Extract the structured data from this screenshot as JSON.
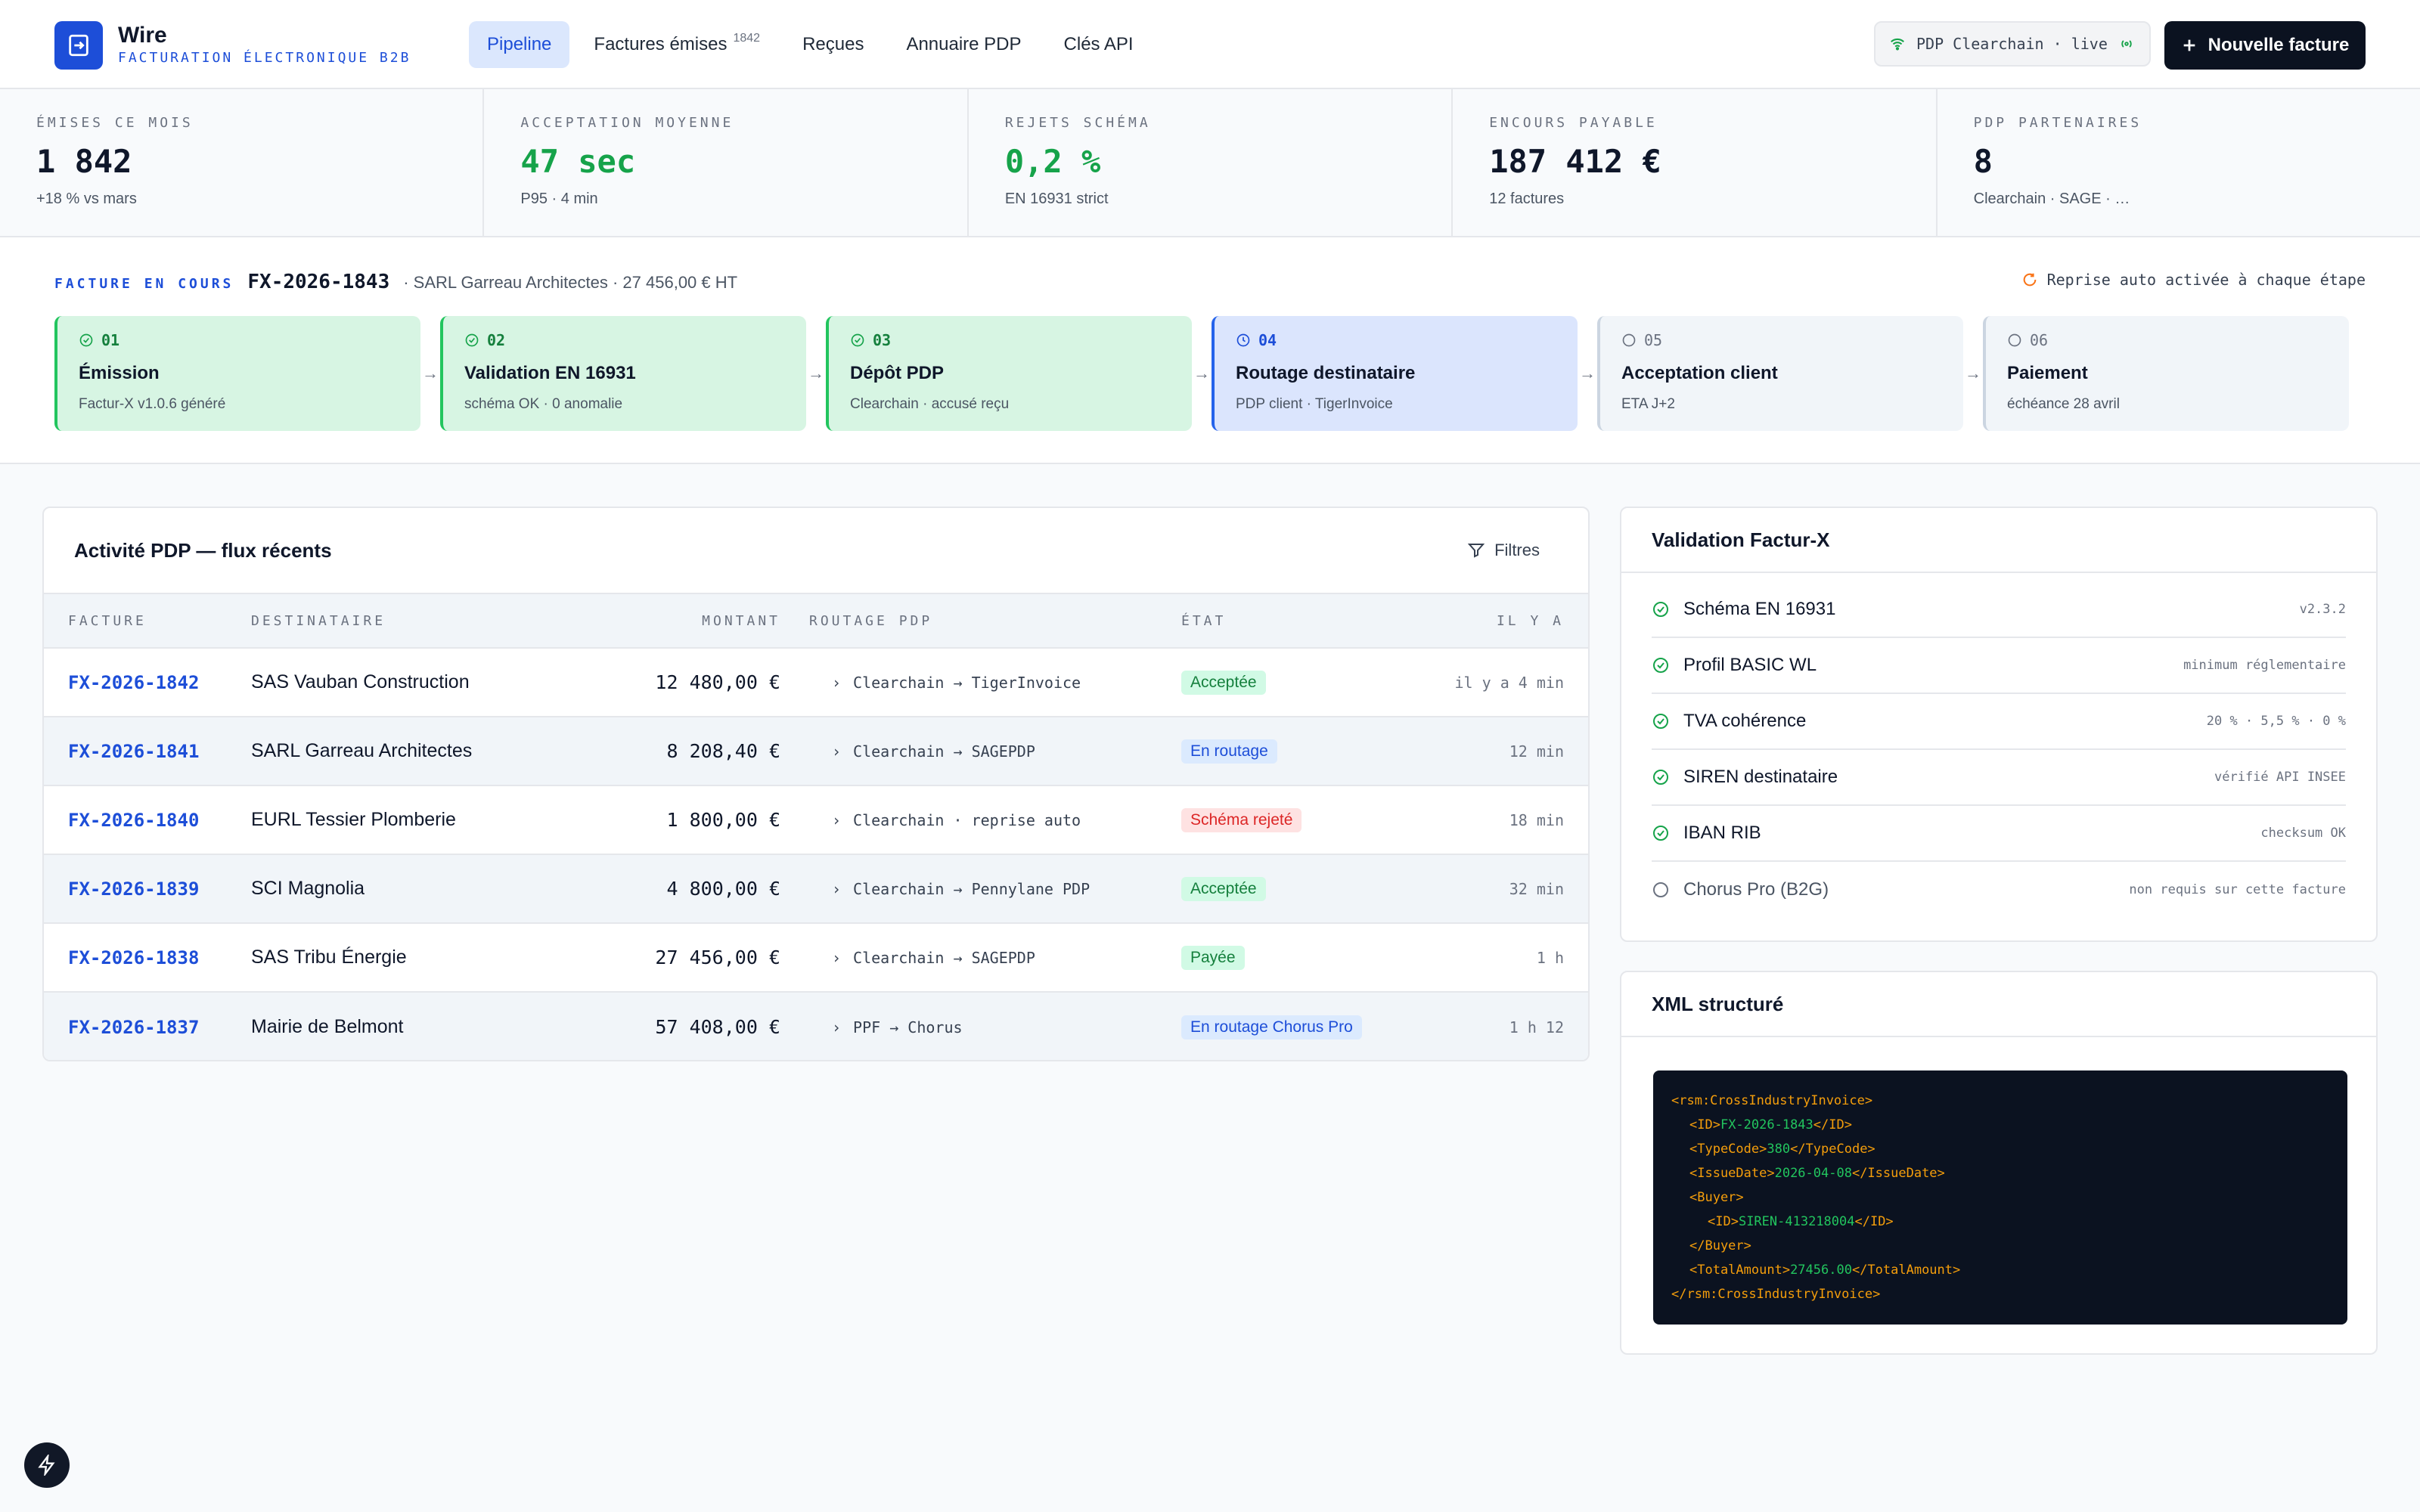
{
  "app": {
    "name": "Wire",
    "subtitle": "FACTURATION ÉLECTRONIQUE B2B"
  },
  "nav": [
    {
      "label": "Pipeline",
      "active": true
    },
    {
      "label": "Factures émises",
      "count": "1842"
    },
    {
      "label": "Reçues"
    },
    {
      "label": "Annuaire PDP"
    },
    {
      "label": "Clés API"
    }
  ],
  "pdp_status": {
    "label": "PDP Clearchain · live"
  },
  "new_invoice_button": {
    "label": "Nouvelle facture"
  },
  "stats": [
    {
      "label": "ÉMISES CE MOIS",
      "value": "1 842",
      "sub": "+18 % vs mars",
      "color": "default"
    },
    {
      "label": "ACCEPTATION MOYENNE",
      "value": "47 sec",
      "sub": "P95 · 4 min",
      "color": "green"
    },
    {
      "label": "REJETS SCHÉMA",
      "value": "0,2 %",
      "sub": "EN 16931 strict",
      "color": "green"
    },
    {
      "label": "ENCOURS PAYABLE",
      "value": "187 412 €",
      "sub": "12 factures",
      "color": "default"
    },
    {
      "label": "PDP PARTENAIRES",
      "value": "8",
      "sub": "Clearchain · SAGE · …",
      "color": "default"
    }
  ],
  "pipeline": {
    "label": "FACTURE EN COURS",
    "invoice_id": "FX-2026-1843",
    "meta": "· SARL Garreau Architectes · 27 456,00 € HT",
    "auto_retry": "Reprise auto activée à chaque étape",
    "steps": [
      {
        "num": "01",
        "title": "Émission",
        "sub": "Factur-X v1.0.6 généré",
        "state": "done"
      },
      {
        "num": "02",
        "title": "Validation EN 16931",
        "sub": "schéma OK · 0 anomalie",
        "state": "done"
      },
      {
        "num": "03",
        "title": "Dépôt PDP",
        "sub": "Clearchain · accusé reçu",
        "state": "done"
      },
      {
        "num": "04",
        "title": "Routage destinataire",
        "sub": "PDP client · TigerInvoice",
        "state": "current"
      },
      {
        "num": "05",
        "title": "Acceptation client",
        "sub": "ETA J+2",
        "state": "pending"
      },
      {
        "num": "06",
        "title": "Paiement",
        "sub": "échéance 28 avril",
        "state": "pending"
      }
    ]
  },
  "activity": {
    "title": "Activité PDP — flux récents",
    "filter_label": "Filtres",
    "columns": [
      "FACTURE",
      "DESTINATAIRE",
      "MONTANT",
      "ROUTAGE PDP",
      "ÉTAT",
      "IL Y A"
    ],
    "rows": [
      {
        "id": "FX-2026-1842",
        "dest": "SAS Vauban Construction",
        "amount": "12 480,00 €",
        "route": "Clearchain → TigerInvoice",
        "state": "Acceptée",
        "state_color": "green",
        "ago": "il y a 4 min"
      },
      {
        "id": "FX-2026-1841",
        "dest": "SARL Garreau Architectes",
        "amount": "8 208,40 €",
        "route": "Clearchain → SAGEPDP",
        "state": "En routage",
        "state_color": "blue",
        "ago": "12 min"
      },
      {
        "id": "FX-2026-1840",
        "dest": "EURL Tessier Plomberie",
        "amount": "1 800,00 €",
        "route": "Clearchain · reprise auto",
        "state": "Schéma rejeté",
        "state_color": "red",
        "ago": "18 min"
      },
      {
        "id": "FX-2026-1839",
        "dest": "SCI Magnolia",
        "amount": "4 800,00 €",
        "route": "Clearchain → Pennylane PDP",
        "state": "Acceptée",
        "state_color": "green",
        "ago": "32 min"
      },
      {
        "id": "FX-2026-1838",
        "dest": "SAS Tribu Énergie",
        "amount": "27 456,00 €",
        "route": "Clearchain → SAGEPDP",
        "state": "Payée",
        "state_color": "green",
        "ago": "1 h"
      },
      {
        "id": "FX-2026-1837",
        "dest": "Mairie de Belmont",
        "amount": "57 408,00 €",
        "route": "PPF → Chorus",
        "state": "En routage Chorus Pro",
        "state_color": "blue",
        "ago": "1 h 12"
      }
    ]
  },
  "validation": {
    "title": "Validation Factur-X",
    "items": [
      {
        "label": "Schéma EN 16931",
        "detail": "v2.3.2",
        "ok": true
      },
      {
        "label": "Profil BASIC WL",
        "detail": "minimum réglementaire",
        "ok": true
      },
      {
        "label": "TVA cohérence",
        "detail": "20 % · 5,5 % · 0 %",
        "ok": true
      },
      {
        "label": "SIREN destinataire",
        "detail": "vérifié API INSEE",
        "ok": true
      },
      {
        "label": "IBAN RIB",
        "detail": "checksum OK",
        "ok": true
      },
      {
        "label": "Chorus Pro (B2G)",
        "detail": "non requis sur cette facture",
        "ok": false
      }
    ]
  },
  "xml": {
    "title": "XML structuré",
    "root_open": "<rsm:CrossIndustryInvoice>",
    "root_close": "</rsm:CrossIndustryInvoice>",
    "id": "FX-2026-1843",
    "type_code": "380",
    "issue_date": "2026-04-08",
    "buyer_id": "SIREN-413218004",
    "total_amount": "27456.00"
  },
  "colors": {
    "accent": "#1d4ed8",
    "success": "#16a34a",
    "danger": "#dc2626",
    "dark": "#0b1220"
  }
}
